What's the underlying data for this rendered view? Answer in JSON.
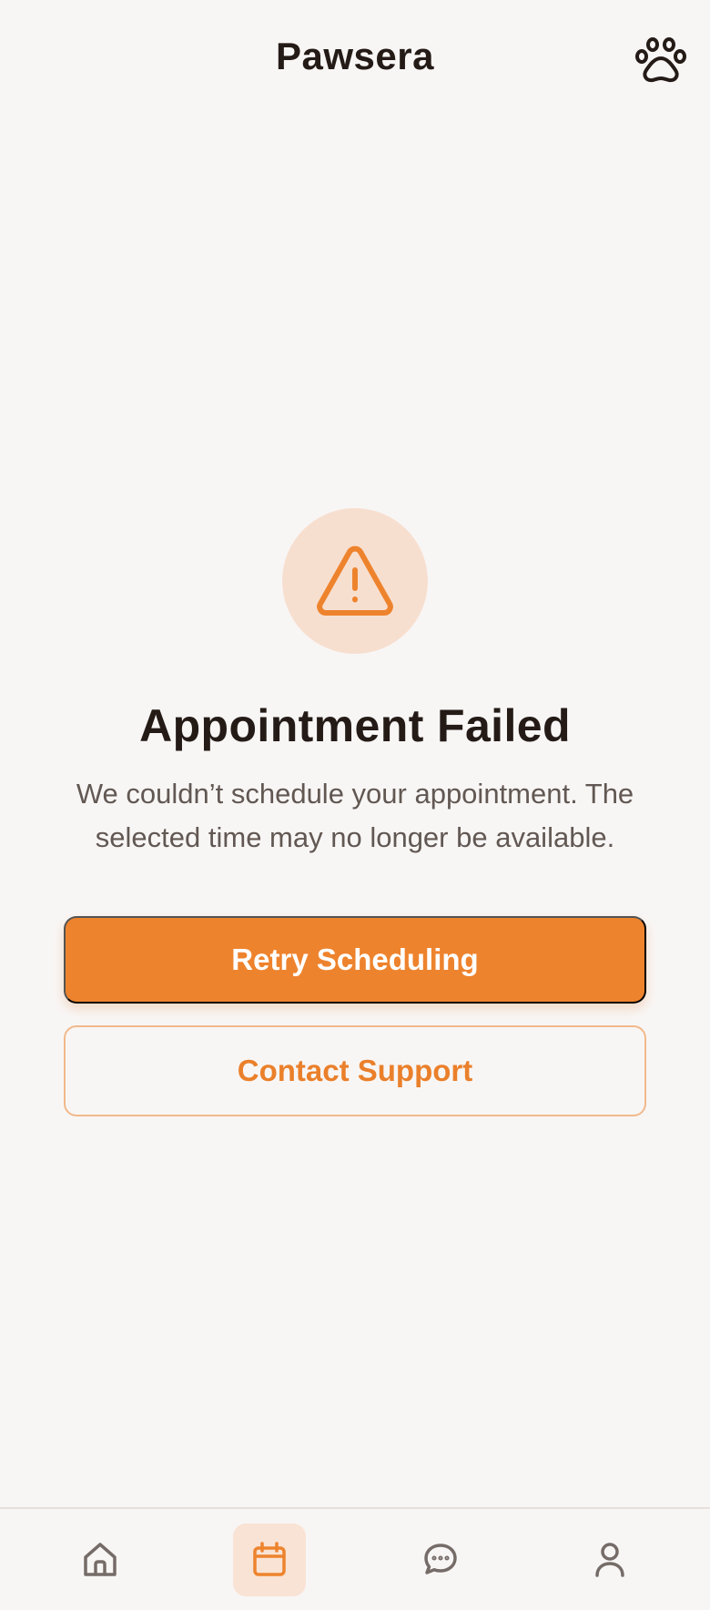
{
  "app": {
    "title": "Pawsera"
  },
  "header": {
    "action_icon": "paw-icon"
  },
  "error": {
    "icon": "warning-triangle-icon",
    "title": "Appointment Failed",
    "message": "We couldn’t schedule your appointment. The selected time may no longer be available."
  },
  "actions": {
    "retry_label": "Retry Scheduling",
    "support_label": "Contact Support"
  },
  "bottom_nav": {
    "items": [
      {
        "name": "home",
        "icon": "home-icon",
        "active": false
      },
      {
        "name": "appointments",
        "icon": "calendar-icon",
        "active": true
      },
      {
        "name": "messages",
        "icon": "chat-bubble-icon",
        "active": false
      },
      {
        "name": "profile",
        "icon": "user-icon",
        "active": false
      }
    ]
  },
  "colors": {
    "accent": "#ee832d",
    "accent_light": "#f7dfd0",
    "text_primary": "#241b17",
    "text_secondary": "#625853",
    "background": "#f8f6f5"
  }
}
